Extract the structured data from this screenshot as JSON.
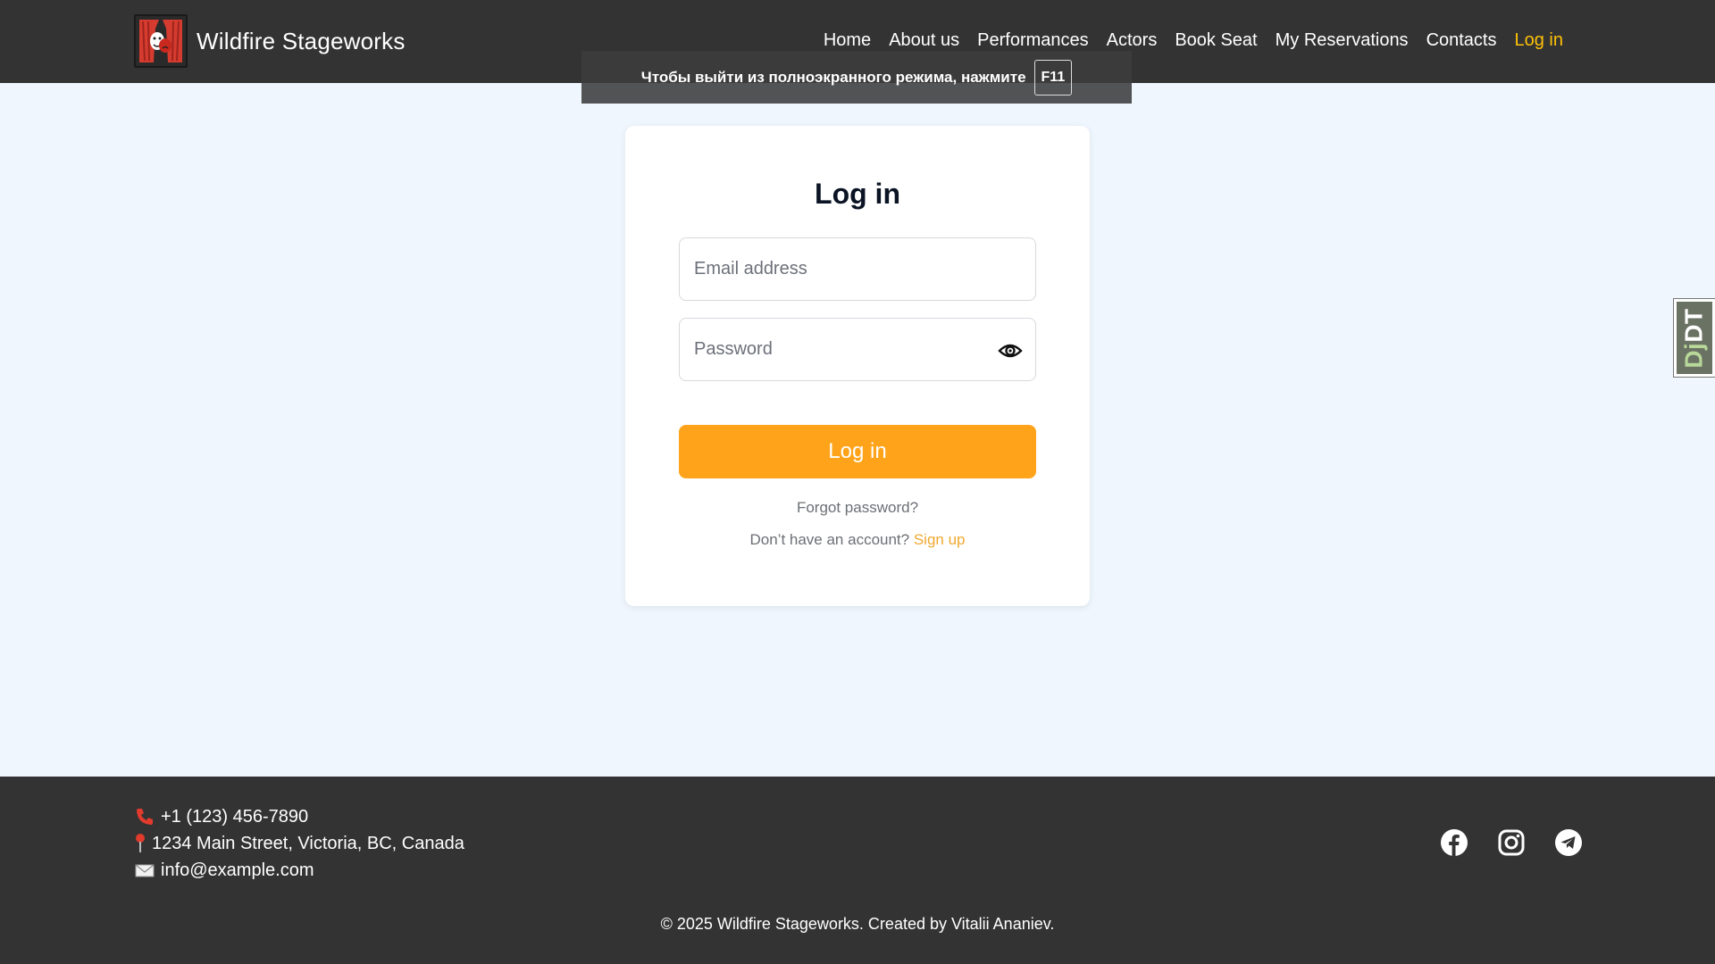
{
  "header": {
    "brand_name": "Wildfire Stageworks",
    "nav": [
      {
        "label": "Home"
      },
      {
        "label": "About us"
      },
      {
        "label": "Performances"
      },
      {
        "label": "Actors"
      },
      {
        "label": "Book Seat"
      },
      {
        "label": "My Reservations"
      },
      {
        "label": "Contacts"
      },
      {
        "label": "Log in",
        "active": true
      }
    ]
  },
  "fullscreen_notice": {
    "text": "Чтобы выйти из полноэкранного режима, нажмите",
    "key": "F11"
  },
  "login": {
    "title": "Log in",
    "email_placeholder": "Email address",
    "password_placeholder": "Password",
    "submit_label": "Log in",
    "forgot_label": "Forgot password?",
    "signup_prompt": "Don’t have an account?",
    "signup_label": "Sign up"
  },
  "djdt": {
    "prefix": "Dj",
    "suffix": "DT"
  },
  "footer": {
    "phone": "+1 (123) 456-7890",
    "address": "1234 Main Street, Victoria, BC, Canada",
    "email": "info@example.com",
    "social_icons": [
      "facebook-icon",
      "instagram-icon",
      "telegram-icon"
    ],
    "copyright": "© 2025 Wildfire Stageworks. Created by Vitalii Ananiev."
  },
  "colors": {
    "header_bg": "#333333",
    "page_bg": "#eff6fe",
    "accent": "#ffa41a",
    "active_nav": "#ffc107",
    "link": "#f0a830"
  }
}
